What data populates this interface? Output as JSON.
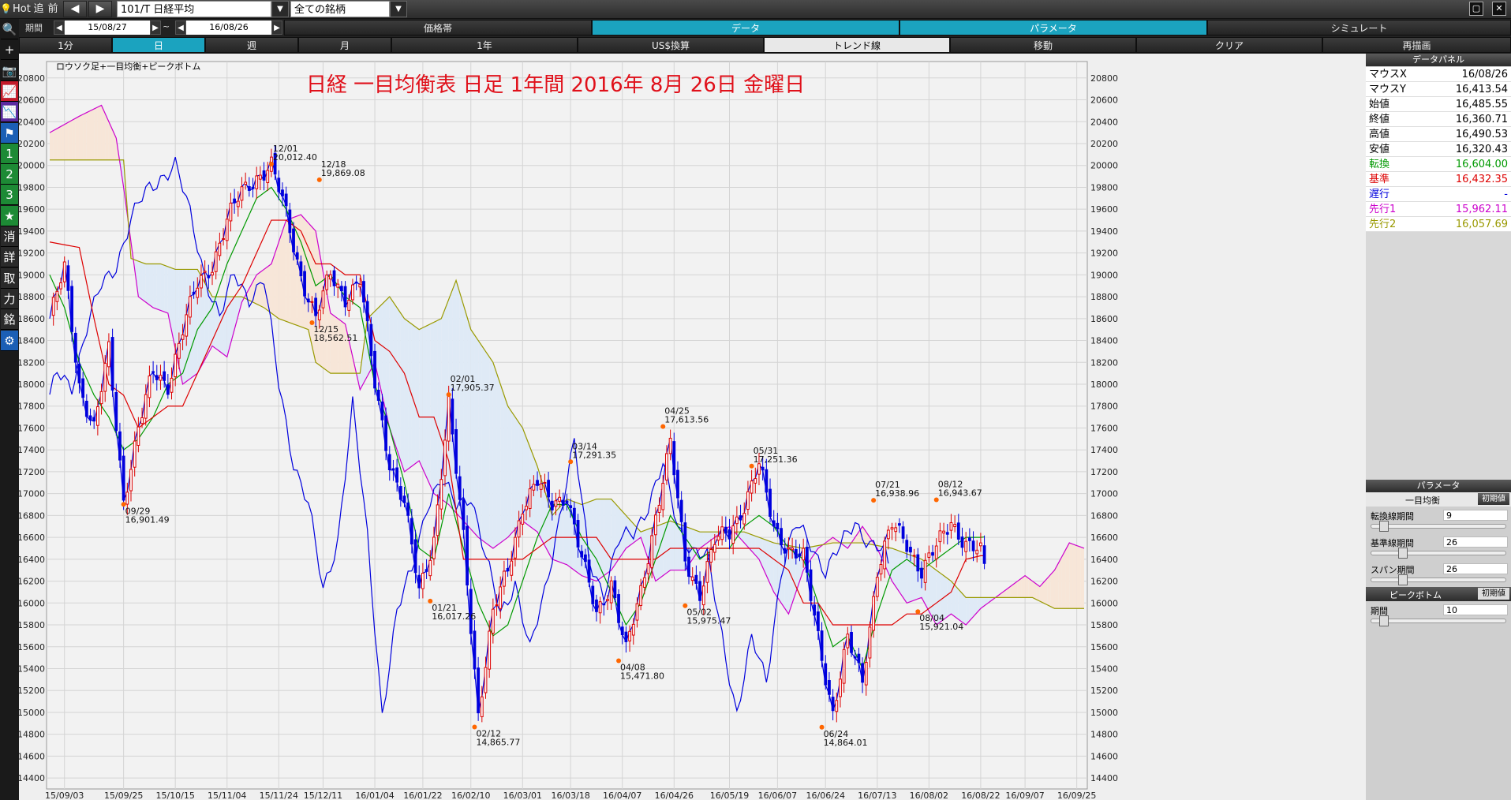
{
  "toolbar": {
    "hot": "Hot",
    "tsui": "追",
    "mae": "前",
    "symbol": "101/T 日経平均",
    "universe": "全ての銘柄",
    "period_label": "期間",
    "date_from": "15/08/27",
    "date_to": "16/08/26",
    "tilde": "~"
  },
  "tabs_row2": [
    "価格帯",
    "データ",
    "パラメータ",
    "シミュレート"
  ],
  "tabs_row3": [
    "1分",
    "日",
    "週",
    "月",
    "1年",
    "US$換算",
    "トレンド線",
    "移動",
    "クリア",
    "再描画"
  ],
  "left_tools": [
    "🔍",
    "+",
    "📷",
    "📈",
    "📉",
    "⚑",
    "1",
    "2",
    "3",
    "★",
    "消",
    "詳",
    "取",
    "力",
    "銘",
    "⚙"
  ],
  "chart_caption": "ロウソク足+一目均衡+ピークボトム",
  "data_panel": {
    "title": "データパネル",
    "rows": [
      {
        "label": "マウスX",
        "value": "16/08/26",
        "color": "#000000"
      },
      {
        "label": "マウスY",
        "value": "16,413.54",
        "color": "#000000"
      },
      {
        "label": "始値",
        "value": "16,485.55",
        "color": "#000000"
      },
      {
        "label": "終値",
        "value": "16,360.71",
        "color": "#000000"
      },
      {
        "label": "高値",
        "value": "16,490.53",
        "color": "#000000"
      },
      {
        "label": "安値",
        "value": "16,320.43",
        "color": "#000000"
      },
      {
        "label": "転換",
        "value": "16,604.00",
        "color": "#009900"
      },
      {
        "label": "基準",
        "value": "16,432.35",
        "color": "#dd0000"
      },
      {
        "label": "遅行",
        "value": "-",
        "color": "#0000dd"
      },
      {
        "label": "先行1",
        "value": "15,962.11",
        "color": "#cc00cc"
      },
      {
        "label": "先行2",
        "value": "16,057.69",
        "color": "#999900"
      }
    ]
  },
  "param_panel": {
    "title": "パラメータ",
    "ichimoku_header": "一目均衡",
    "init_btn": "初期値",
    "tenkan_label": "転換線期間",
    "tenkan_value": "9",
    "kijun_label": "基準線期間",
    "kijun_value": "26",
    "span_label": "スパン期間",
    "span_value": "26",
    "peak_header": "ピークボトム",
    "peak_label": "期間",
    "peak_value": "10"
  },
  "chart_data": {
    "type": "line",
    "title": "日経 一目均衡表 日足 1年間 2016年 8月 26日 金曜日",
    "ylim": [
      14300,
      20950
    ],
    "y_ticks": [
      14400,
      14600,
      14800,
      15000,
      15200,
      15400,
      15600,
      15800,
      16000,
      16200,
      16400,
      16600,
      16800,
      17000,
      17200,
      17400,
      17600,
      17800,
      18000,
      18200,
      18400,
      18600,
      18800,
      19000,
      19200,
      19400,
      19600,
      19800,
      20000,
      20200,
      20400,
      20600,
      20800
    ],
    "x_ticks": [
      "15/09/03",
      "15/09/25",
      "15/10/15",
      "15/11/04",
      "15/11/24",
      "15/12/11",
      "16/01/04",
      "16/01/22",
      "16/02/10",
      "16/03/01",
      "16/03/18",
      "16/04/07",
      "16/04/26",
      "16/05/19",
      "16/06/07",
      "16/06/24",
      "16/07/13",
      "16/08/02",
      "16/08/22",
      "16/09/07",
      "16/09/25"
    ],
    "x_tick_index": [
      4,
      20,
      34,
      48,
      62,
      74,
      88,
      101,
      114,
      128,
      141,
      155,
      169,
      184,
      197,
      210,
      224,
      238,
      252,
      264,
      278
    ],
    "n_days": 281,
    "last_index": 253,
    "colors": {
      "up": "#dd0000",
      "down": "#0000dd",
      "tenkan": "#009900",
      "kijun": "#dd0000",
      "chikou": "#0000dd",
      "senkou1": "#cc00cc",
      "senkou2": "#999900",
      "kumo_up": "#f7e6d8",
      "kumo_down": "#dfeaf6"
    },
    "close_knots": [
      [
        0,
        18600
      ],
      [
        4,
        19050
      ],
      [
        8,
        18000
      ],
      [
        12,
        17600
      ],
      [
        16,
        18300
      ],
      [
        20,
        16950
      ],
      [
        24,
        17600
      ],
      [
        28,
        18100
      ],
      [
        32,
        18000
      ],
      [
        36,
        18500
      ],
      [
        40,
        18900
      ],
      [
        44,
        19100
      ],
      [
        48,
        19500
      ],
      [
        52,
        19750
      ],
      [
        56,
        19900
      ],
      [
        60,
        20000
      ],
      [
        64,
        19550
      ],
      [
        68,
        19000
      ],
      [
        72,
        18600
      ],
      [
        76,
        19000
      ],
      [
        80,
        18800
      ],
      [
        84,
        18950
      ],
      [
        88,
        18000
      ],
      [
        92,
        17300
      ],
      [
        96,
        16900
      ],
      [
        100,
        16100
      ],
      [
        104,
        16600
      ],
      [
        108,
        17800
      ],
      [
        112,
        16600
      ],
      [
        116,
        15000
      ],
      [
        120,
        15900
      ],
      [
        124,
        16300
      ],
      [
        128,
        16900
      ],
      [
        132,
        17100
      ],
      [
        136,
        16900
      ],
      [
        140,
        17000
      ],
      [
        144,
        16400
      ],
      [
        148,
        15900
      ],
      [
        152,
        16200
      ],
      [
        156,
        15550
      ],
      [
        160,
        16100
      ],
      [
        164,
        16800
      ],
      [
        168,
        17450
      ],
      [
        172,
        16400
      ],
      [
        176,
        16100
      ],
      [
        180,
        16550
      ],
      [
        184,
        16650
      ],
      [
        188,
        16900
      ],
      [
        192,
        17250
      ],
      [
        196,
        16700
      ],
      [
        200,
        16500
      ],
      [
        204,
        16400
      ],
      [
        208,
        15700
      ],
      [
        212,
        15000
      ],
      [
        216,
        15650
      ],
      [
        220,
        15300
      ],
      [
        224,
        16300
      ],
      [
        228,
        16700
      ],
      [
        232,
        16550
      ],
      [
        236,
        16300
      ],
      [
        240,
        16500
      ],
      [
        244,
        16750
      ],
      [
        248,
        16550
      ],
      [
        252,
        16450
      ],
      [
        253,
        16361
      ]
    ],
    "span1_knots": [
      [
        0,
        20300
      ],
      [
        8,
        20450
      ],
      [
        14,
        20550
      ],
      [
        18,
        20250
      ],
      [
        20,
        19800
      ],
      [
        24,
        18800
      ],
      [
        28,
        18700
      ],
      [
        32,
        18650
      ],
      [
        36,
        18000
      ],
      [
        40,
        18100
      ],
      [
        44,
        18350
      ],
      [
        48,
        18250
      ],
      [
        52,
        18750
      ],
      [
        56,
        19000
      ],
      [
        60,
        19100
      ],
      [
        64,
        19500
      ],
      [
        68,
        19550
      ],
      [
        72,
        19400
      ],
      [
        76,
        18650
      ],
      [
        80,
        18550
      ],
      [
        84,
        17950
      ],
      [
        88,
        18200
      ],
      [
        92,
        17600
      ],
      [
        96,
        17200
      ],
      [
        100,
        17300
      ],
      [
        104,
        17000
      ],
      [
        108,
        16900
      ],
      [
        112,
        16750
      ],
      [
        116,
        16600
      ],
      [
        120,
        16500
      ],
      [
        124,
        16600
      ],
      [
        128,
        16750
      ],
      [
        132,
        16650
      ],
      [
        136,
        16400
      ],
      [
        140,
        16350
      ],
      [
        144,
        16250
      ],
      [
        148,
        16200
      ],
      [
        152,
        16300
      ],
      [
        156,
        16500
      ],
      [
        160,
        16600
      ],
      [
        164,
        16200
      ],
      [
        168,
        16300
      ],
      [
        172,
        16300
      ],
      [
        176,
        16500
      ],
      [
        180,
        16600
      ],
      [
        184,
        16700
      ],
      [
        188,
        16550
      ],
      [
        192,
        16400
      ],
      [
        196,
        16100
      ],
      [
        200,
        15900
      ],
      [
        204,
        16300
      ],
      [
        208,
        16500
      ],
      [
        212,
        16600
      ],
      [
        216,
        16500
      ],
      [
        220,
        16700
      ],
      [
        224,
        16500
      ],
      [
        228,
        16200
      ],
      [
        232,
        16000
      ],
      [
        236,
        16050
      ],
      [
        240,
        15800
      ],
      [
        244,
        15900
      ],
      [
        248,
        15800
      ],
      [
        252,
        15950
      ],
      [
        256,
        16050
      ],
      [
        260,
        16150
      ],
      [
        264,
        16250
      ],
      [
        268,
        16150
      ],
      [
        272,
        16300
      ],
      [
        276,
        16550
      ],
      [
        280,
        16500
      ]
    ],
    "span2_knots": [
      [
        0,
        20050
      ],
      [
        20,
        20050
      ],
      [
        22,
        19150
      ],
      [
        26,
        19100
      ],
      [
        30,
        19100
      ],
      [
        34,
        19050
      ],
      [
        40,
        19050
      ],
      [
        44,
        18800
      ],
      [
        48,
        18800
      ],
      [
        52,
        18800
      ],
      [
        58,
        18700
      ],
      [
        62,
        18600
      ],
      [
        70,
        18500
      ],
      [
        72,
        18200
      ],
      [
        76,
        18100
      ],
      [
        84,
        18100
      ],
      [
        86,
        18600
      ],
      [
        92,
        18800
      ],
      [
        96,
        18600
      ],
      [
        100,
        18500
      ],
      [
        106,
        18600
      ],
      [
        110,
        18950
      ],
      [
        114,
        18500
      ],
      [
        120,
        18200
      ],
      [
        124,
        17800
      ],
      [
        128,
        17600
      ],
      [
        132,
        17250
      ],
      [
        136,
        16800
      ],
      [
        140,
        16950
      ],
      [
        144,
        16900
      ],
      [
        148,
        16950
      ],
      [
        152,
        16950
      ],
      [
        160,
        16650
      ],
      [
        168,
        16750
      ],
      [
        176,
        16650
      ],
      [
        188,
        16650
      ],
      [
        196,
        16550
      ],
      [
        204,
        16500
      ],
      [
        212,
        16550
      ],
      [
        220,
        16550
      ],
      [
        228,
        16500
      ],
      [
        236,
        16400
      ],
      [
        244,
        16200
      ],
      [
        248,
        16050
      ],
      [
        256,
        16050
      ],
      [
        262,
        16050
      ],
      [
        266,
        16050
      ],
      [
        272,
        15950
      ],
      [
        280,
        15950
      ]
    ],
    "tenkan_knots": [
      [
        0,
        19000
      ],
      [
        4,
        18700
      ],
      [
        8,
        18200
      ],
      [
        12,
        17900
      ],
      [
        16,
        17700
      ],
      [
        20,
        17400
      ],
      [
        24,
        17500
      ],
      [
        28,
        17700
      ],
      [
        32,
        18000
      ],
      [
        36,
        18100
      ],
      [
        40,
        18500
      ],
      [
        44,
        18700
      ],
      [
        48,
        19100
      ],
      [
        52,
        19400
      ],
      [
        56,
        19700
      ],
      [
        60,
        19800
      ],
      [
        64,
        19600
      ],
      [
        68,
        19300
      ],
      [
        72,
        18900
      ],
      [
        76,
        19000
      ],
      [
        80,
        18800
      ],
      [
        84,
        18700
      ],
      [
        88,
        18000
      ],
      [
        92,
        17600
      ],
      [
        96,
        17100
      ],
      [
        100,
        16500
      ],
      [
        104,
        16400
      ],
      [
        108,
        17000
      ],
      [
        112,
        16500
      ],
      [
        116,
        16000
      ],
      [
        120,
        15700
      ],
      [
        124,
        15800
      ],
      [
        128,
        16200
      ],
      [
        132,
        16600
      ],
      [
        136,
        16900
      ],
      [
        140,
        16900
      ],
      [
        144,
        16600
      ],
      [
        148,
        16400
      ],
      [
        152,
        16100
      ],
      [
        156,
        15800
      ],
      [
        160,
        16000
      ],
      [
        164,
        16400
      ],
      [
        168,
        16800
      ],
      [
        172,
        16600
      ],
      [
        176,
        16400
      ],
      [
        180,
        16500
      ],
      [
        184,
        16500
      ],
      [
        188,
        16700
      ],
      [
        192,
        16800
      ],
      [
        196,
        16700
      ],
      [
        200,
        16500
      ],
      [
        204,
        16400
      ],
      [
        208,
        16000
      ],
      [
        212,
        15600
      ],
      [
        216,
        15700
      ],
      [
        220,
        15400
      ],
      [
        224,
        15900
      ],
      [
        228,
        16300
      ],
      [
        232,
        16400
      ],
      [
        236,
        16300
      ],
      [
        240,
        16400
      ],
      [
        244,
        16500
      ],
      [
        248,
        16600
      ],
      [
        252,
        16600
      ],
      [
        253,
        16604
      ]
    ],
    "kijun_knots": [
      [
        0,
        19300
      ],
      [
        8,
        19250
      ],
      [
        12,
        18600
      ],
      [
        16,
        18000
      ],
      [
        20,
        17900
      ],
      [
        24,
        17600
      ],
      [
        28,
        17700
      ],
      [
        32,
        17800
      ],
      [
        36,
        17800
      ],
      [
        40,
        18100
      ],
      [
        44,
        18400
      ],
      [
        48,
        18700
      ],
      [
        52,
        18900
      ],
      [
        56,
        19200
      ],
      [
        60,
        19500
      ],
      [
        64,
        19500
      ],
      [
        68,
        19400
      ],
      [
        72,
        19100
      ],
      [
        76,
        19100
      ],
      [
        80,
        19000
      ],
      [
        84,
        19000
      ],
      [
        88,
        18400
      ],
      [
        92,
        18300
      ],
      [
        96,
        18100
      ],
      [
        100,
        17700
      ],
      [
        104,
        17700
      ],
      [
        108,
        17300
      ],
      [
        112,
        16400
      ],
      [
        116,
        16400
      ],
      [
        120,
        16400
      ],
      [
        124,
        16400
      ],
      [
        128,
        16400
      ],
      [
        132,
        16500
      ],
      [
        136,
        16600
      ],
      [
        140,
        16600
      ],
      [
        144,
        16600
      ],
      [
        148,
        16600
      ],
      [
        152,
        16400
      ],
      [
        156,
        16400
      ],
      [
        160,
        16400
      ],
      [
        164,
        16400
      ],
      [
        168,
        16500
      ],
      [
        172,
        16500
      ],
      [
        176,
        16500
      ],
      [
        180,
        16500
      ],
      [
        184,
        16500
      ],
      [
        188,
        16500
      ],
      [
        192,
        16500
      ],
      [
        196,
        16400
      ],
      [
        200,
        16300
      ],
      [
        204,
        16000
      ],
      [
        208,
        16000
      ],
      [
        212,
        15800
      ],
      [
        216,
        15800
      ],
      [
        220,
        15800
      ],
      [
        224,
        15800
      ],
      [
        228,
        15800
      ],
      [
        232,
        15900
      ],
      [
        236,
        15900
      ],
      [
        240,
        16000
      ],
      [
        244,
        16100
      ],
      [
        248,
        16400
      ],
      [
        252,
        16432
      ],
      [
        253,
        16432
      ]
    ],
    "peaks": [
      {
        "i": 60,
        "v": 20012.4,
        "date": "12/01",
        "label": "20,012.40",
        "pos": "above"
      },
      {
        "i": 73,
        "v": 19869.08,
        "date": "12/18",
        "label": "19,869.08",
        "pos": "above"
      },
      {
        "i": 108,
        "v": 17905.37,
        "date": "02/01",
        "label": "17,905.37",
        "pos": "above"
      },
      {
        "i": 141,
        "v": 17291.35,
        "date": "03/14",
        "label": "17,291.35",
        "pos": "above"
      },
      {
        "i": 166,
        "v": 17613.56,
        "date": "04/25",
        "label": "17,613.56",
        "pos": "above"
      },
      {
        "i": 190,
        "v": 17251.36,
        "date": "05/31",
        "label": "17,251.36",
        "pos": "above"
      },
      {
        "i": 223,
        "v": 16938.96,
        "date": "07/21",
        "label": "16,938.96",
        "pos": "above"
      },
      {
        "i": 240,
        "v": 16943.67,
        "date": "08/12",
        "label": "16,943.67",
        "pos": "above"
      }
    ],
    "bottoms": [
      {
        "i": 20,
        "v": 16901.49,
        "date": "09/29",
        "label": "16,901.49"
      },
      {
        "i": 71,
        "v": 18562.51,
        "date": "12/15",
        "label": "18,562.51"
      },
      {
        "i": 103,
        "v": 16017.26,
        "date": "01/21",
        "label": "16,017.26"
      },
      {
        "i": 115,
        "v": 14865.77,
        "date": "02/12",
        "label": "14,865.77"
      },
      {
        "i": 154,
        "v": 15471.8,
        "date": "04/08",
        "label": "15,471.80"
      },
      {
        "i": 172,
        "v": 15975.47,
        "date": "05/02",
        "label": "15,975.47"
      },
      {
        "i": 209,
        "v": 14864.01,
        "date": "06/24",
        "label": "14,864.01"
      },
      {
        "i": 235,
        "v": 15921.04,
        "date": "08/04",
        "label": "15,921.04"
      }
    ]
  }
}
